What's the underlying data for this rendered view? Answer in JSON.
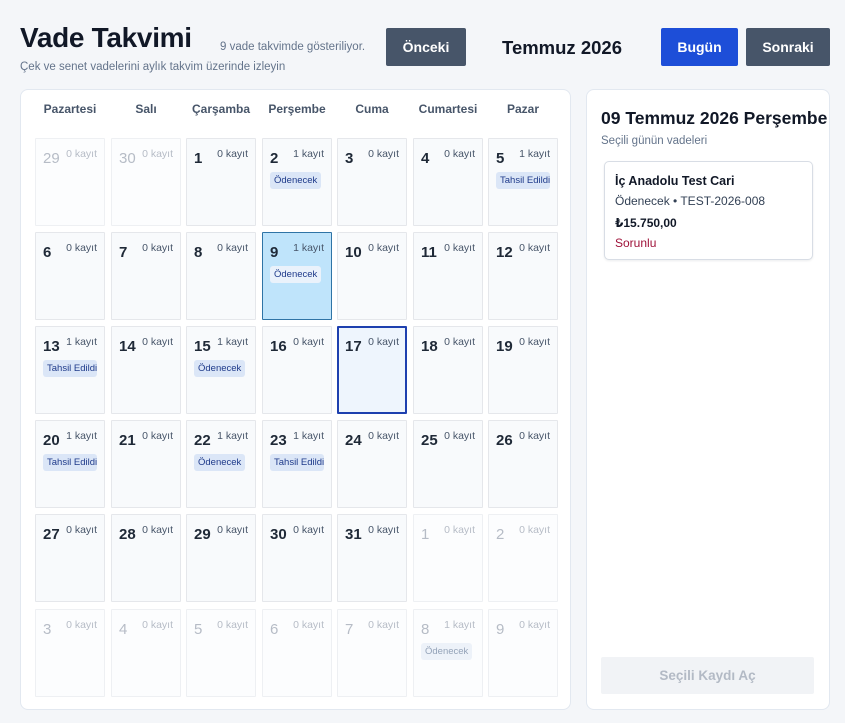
{
  "header": {
    "title": "Vade Takvimi",
    "subtitle": "Çek ve senet vadelerini aylık takvim üzerinde izleyin",
    "count_info": "9 vade takvimde gösteriliyor.",
    "prev_label": "Önceki",
    "month_label": "Temmuz 2026",
    "today_label": "Bugün",
    "next_label": "Sonraki"
  },
  "calendar": {
    "weekdays": [
      "Pazartesi",
      "Salı",
      "Çarşamba",
      "Perşembe",
      "Cuma",
      "Cumartesi",
      "Pazar"
    ],
    "days": [
      {
        "day": "29",
        "count": "0 kayıt",
        "badge": "",
        "state": "out"
      },
      {
        "day": "30",
        "count": "0 kayıt",
        "badge": "",
        "state": "out"
      },
      {
        "day": "1",
        "count": "0 kayıt",
        "badge": "",
        "state": "in"
      },
      {
        "day": "2",
        "count": "1 kayıt",
        "badge": "Ödenecek",
        "state": "in"
      },
      {
        "day": "3",
        "count": "0 kayıt",
        "badge": "",
        "state": "in"
      },
      {
        "day": "4",
        "count": "0 kayıt",
        "badge": "",
        "state": "in"
      },
      {
        "day": "5",
        "count": "1 kayıt",
        "badge": "Tahsil Edildi",
        "state": "in"
      },
      {
        "day": "6",
        "count": "0 kayıt",
        "badge": "",
        "state": "in"
      },
      {
        "day": "7",
        "count": "0 kayıt",
        "badge": "",
        "state": "in"
      },
      {
        "day": "8",
        "count": "0 kayıt",
        "badge": "",
        "state": "in"
      },
      {
        "day": "9",
        "count": "1 kayıt",
        "badge": "Ödenecek",
        "state": "selected"
      },
      {
        "day": "10",
        "count": "0 kayıt",
        "badge": "",
        "state": "in"
      },
      {
        "day": "11",
        "count": "0 kayıt",
        "badge": "",
        "state": "in"
      },
      {
        "day": "12",
        "count": "0 kayıt",
        "badge": "",
        "state": "in"
      },
      {
        "day": "13",
        "count": "1 kayıt",
        "badge": "Tahsil Edildi",
        "state": "in"
      },
      {
        "day": "14",
        "count": "0 kayıt",
        "badge": "",
        "state": "in"
      },
      {
        "day": "15",
        "count": "1 kayıt",
        "badge": "Ödenecek",
        "state": "in"
      },
      {
        "day": "16",
        "count": "0 kayıt",
        "badge": "",
        "state": "in"
      },
      {
        "day": "17",
        "count": "0 kayıt",
        "badge": "",
        "state": "today"
      },
      {
        "day": "18",
        "count": "0 kayıt",
        "badge": "",
        "state": "in"
      },
      {
        "day": "19",
        "count": "0 kayıt",
        "badge": "",
        "state": "in"
      },
      {
        "day": "20",
        "count": "1 kayıt",
        "badge": "Tahsil Edildi",
        "state": "in"
      },
      {
        "day": "21",
        "count": "0 kayıt",
        "badge": "",
        "state": "in"
      },
      {
        "day": "22",
        "count": "1 kayıt",
        "badge": "Ödenecek",
        "state": "in"
      },
      {
        "day": "23",
        "count": "1 kayıt",
        "badge": "Tahsil Edildi",
        "state": "in"
      },
      {
        "day": "24",
        "count": "0 kayıt",
        "badge": "",
        "state": "in"
      },
      {
        "day": "25",
        "count": "0 kayıt",
        "badge": "",
        "state": "in"
      },
      {
        "day": "26",
        "count": "0 kayıt",
        "badge": "",
        "state": "in"
      },
      {
        "day": "27",
        "count": "0 kayıt",
        "badge": "",
        "state": "in"
      },
      {
        "day": "28",
        "count": "0 kayıt",
        "badge": "",
        "state": "in"
      },
      {
        "day": "29",
        "count": "0 kayıt",
        "badge": "",
        "state": "in"
      },
      {
        "day": "30",
        "count": "0 kayıt",
        "badge": "",
        "state": "in"
      },
      {
        "day": "31",
        "count": "0 kayıt",
        "badge": "",
        "state": "in"
      },
      {
        "day": "1",
        "count": "0 kayıt",
        "badge": "",
        "state": "out"
      },
      {
        "day": "2",
        "count": "0 kayıt",
        "badge": "",
        "state": "out"
      },
      {
        "day": "3",
        "count": "0 kayıt",
        "badge": "",
        "state": "out"
      },
      {
        "day": "4",
        "count": "0 kayıt",
        "badge": "",
        "state": "out"
      },
      {
        "day": "5",
        "count": "0 kayıt",
        "badge": "",
        "state": "out"
      },
      {
        "day": "6",
        "count": "0 kayıt",
        "badge": "",
        "state": "out"
      },
      {
        "day": "7",
        "count": "0 kayıt",
        "badge": "",
        "state": "out"
      },
      {
        "day": "8",
        "count": "1 kayıt",
        "badge": "Ödenecek",
        "state": "out"
      },
      {
        "day": "9",
        "count": "0 kayıt",
        "badge": "",
        "state": "out"
      }
    ]
  },
  "panel": {
    "title": "09 Temmuz 2026 Perşembe",
    "subtitle": "Seçili günün vadeleri",
    "record": {
      "name": "İç Anadolu Test Cari",
      "meta": "Ödenecek  •  TEST-2026-008",
      "amount": "₺15.750,00",
      "status": "Sorunlu"
    },
    "open_label": "Seçili Kaydı Aç"
  },
  "colors": {
    "primary": "#1d4ed8",
    "secondary": "#475569",
    "selected_day": "#bfe4fb",
    "today_border": "#1e40af",
    "badge_bg": "#dbe6f7",
    "status_problem": "#9f1239"
  }
}
